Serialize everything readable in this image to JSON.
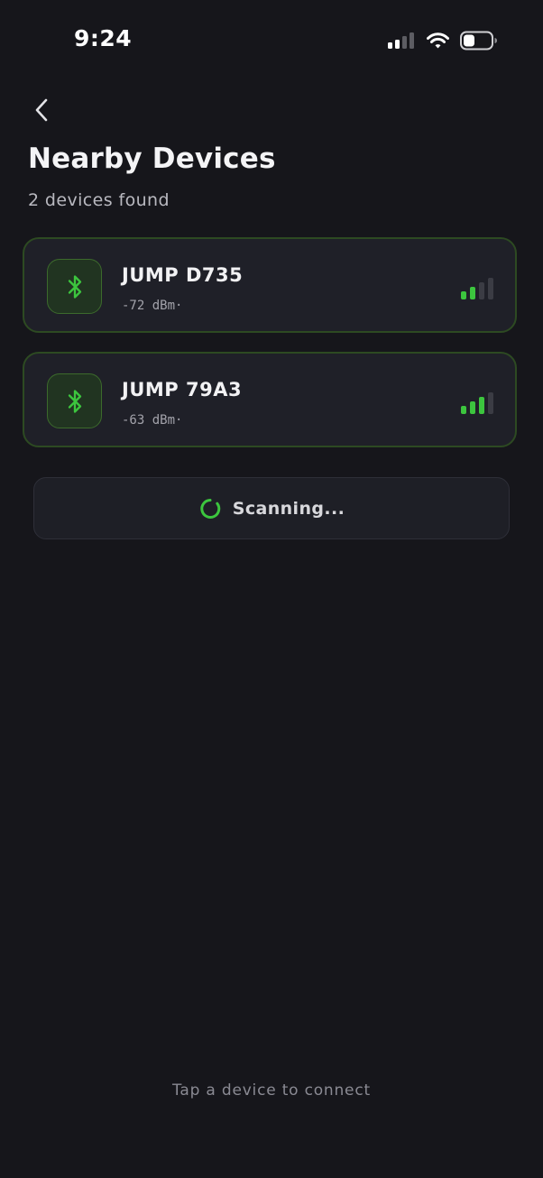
{
  "status_bar": {
    "time": "9:24",
    "icons": [
      "cellular-signal-icon",
      "wifi-icon",
      "battery-icon"
    ]
  },
  "header": {
    "back_icon": "chevron-left-icon",
    "title": "Nearby Devices",
    "subtitle": "2 devices found"
  },
  "devices": [
    {
      "name": "JUMP D735",
      "rssi": "-72 dBm·",
      "signal_level": 2,
      "signal_max": 4,
      "icon": "bluetooth-icon"
    },
    {
      "name": "JUMP 79A3",
      "rssi": "-63 dBm·",
      "signal_level": 3,
      "signal_max": 4,
      "icon": "bluetooth-icon"
    }
  ],
  "scan": {
    "label": "Scanning...",
    "icon": "spinner-icon"
  },
  "footer": {
    "hint": "Tap a device to connect"
  },
  "colors": {
    "background": "#16161b",
    "accent": "#3cc53e",
    "card_border": "#2d4a22",
    "signal_inactive": "#3b3c44"
  }
}
